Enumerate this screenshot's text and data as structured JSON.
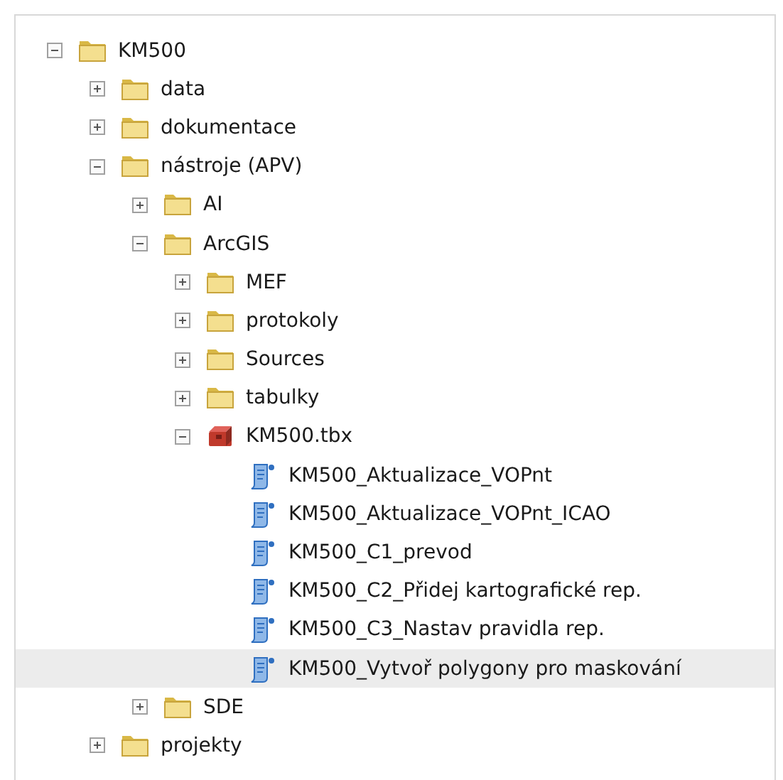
{
  "tree": [
    {
      "label": "KM500",
      "kind": "folder",
      "expanded": true,
      "selected": false,
      "children": [
        {
          "label": "data",
          "kind": "folder",
          "expanded": false,
          "selected": false
        },
        {
          "label": "dokumentace",
          "kind": "folder",
          "expanded": false,
          "selected": false
        },
        {
          "label": "nástroje (APV)",
          "kind": "folder",
          "expanded": true,
          "selected": false,
          "children": [
            {
              "label": "AI",
              "kind": "folder",
              "expanded": false,
              "selected": false
            },
            {
              "label": "ArcGIS",
              "kind": "folder",
              "expanded": true,
              "selected": false,
              "children": [
                {
                  "label": "MEF",
                  "kind": "folder",
                  "expanded": false,
                  "selected": false
                },
                {
                  "label": "protokoly",
                  "kind": "folder",
                  "expanded": false,
                  "selected": false
                },
                {
                  "label": "Sources",
                  "kind": "folder",
                  "expanded": false,
                  "selected": false
                },
                {
                  "label": "tabulky",
                  "kind": "folder",
                  "expanded": false,
                  "selected": false
                },
                {
                  "label": "KM500.tbx",
                  "kind": "toolbox",
                  "expanded": true,
                  "selected": false,
                  "children": [
                    {
                      "label": "KM500_Aktualizace_VOPnt",
                      "kind": "script",
                      "selected": false
                    },
                    {
                      "label": "KM500_Aktualizace_VOPnt_ICAO",
                      "kind": "script",
                      "selected": false
                    },
                    {
                      "label": "KM500_C1_prevod",
                      "kind": "script",
                      "selected": false
                    },
                    {
                      "label": "KM500_C2_Přidej kartografické rep.",
                      "kind": "script",
                      "selected": false
                    },
                    {
                      "label": "KM500_C3_Nastav pravidla rep.",
                      "kind": "script",
                      "selected": false
                    },
                    {
                      "label": "KM500_Vytvoř polygony pro maskování",
                      "kind": "script",
                      "selected": true
                    }
                  ]
                }
              ]
            },
            {
              "label": "SDE",
              "kind": "folder",
              "expanded": false,
              "selected": false
            }
          ]
        },
        {
          "label": "projekty",
          "kind": "folder",
          "expanded": false,
          "selected": false
        }
      ]
    }
  ]
}
